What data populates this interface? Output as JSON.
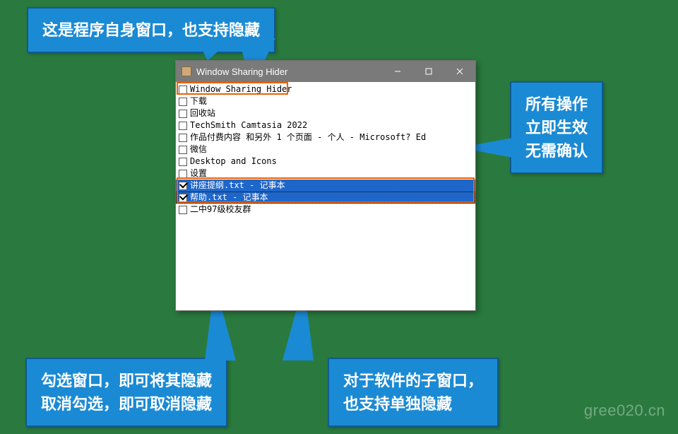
{
  "callouts": {
    "top": "这是程序自身窗口，也支持隐藏",
    "right": "所有操作\n立即生效\n无需确认",
    "bottom_left": "勾选窗口，即可将其隐藏\n取消勾选，即可取消隐藏",
    "bottom_right": "对于软件的子窗口，\n也支持单独隐藏"
  },
  "window": {
    "title": "Window Sharing Hider",
    "items": [
      {
        "label": "Window Sharing Hider",
        "checked": false,
        "selected": false
      },
      {
        "label": "下载",
        "checked": false,
        "selected": false
      },
      {
        "label": "回收站",
        "checked": false,
        "selected": false
      },
      {
        "label": "TechSmith Camtasia 2022",
        "checked": false,
        "selected": false
      },
      {
        "label": "作品付费内容 和另外 1 个页面 - 个人 - Microsoft? Ed",
        "checked": false,
        "selected": false
      },
      {
        "label": "微信",
        "checked": false,
        "selected": false
      },
      {
        "label": "Desktop and Icons",
        "checked": false,
        "selected": false
      },
      {
        "label": "设置",
        "checked": false,
        "selected": false
      },
      {
        "label": "讲座提纲.txt - 记事本",
        "checked": true,
        "selected": true
      },
      {
        "label": "帮助.txt - 记事本",
        "checked": true,
        "selected": true,
        "focus": true
      },
      {
        "label": "二中97级校友群",
        "checked": false,
        "selected": false
      }
    ]
  },
  "watermark": "gree020.cn"
}
